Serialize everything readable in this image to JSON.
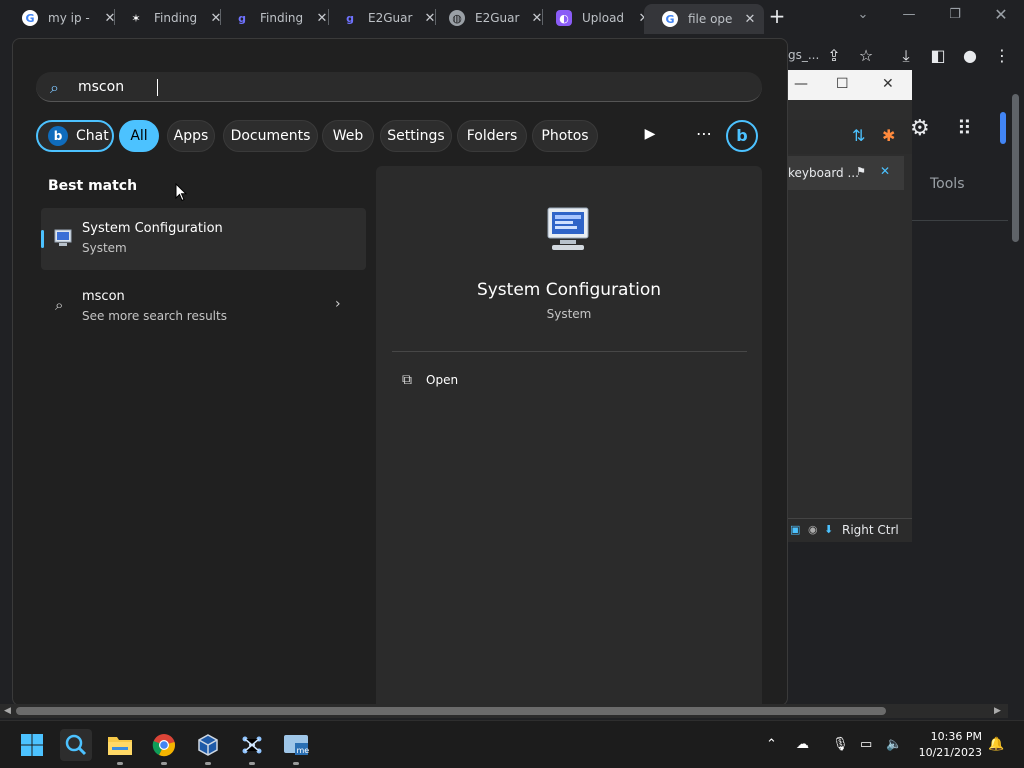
{
  "browser": {
    "tabs": [
      {
        "label": "my ip -",
        "icon": "google-icon"
      },
      {
        "label": "Finding",
        "icon": "spark-icon"
      },
      {
        "label": "Finding",
        "icon": "g-icon"
      },
      {
        "label": "E2Guar",
        "icon": "g-icon"
      },
      {
        "label": "E2Guar",
        "icon": "globe-icon"
      },
      {
        "label": "Upload",
        "icon": "upload-app-icon"
      },
      {
        "label": "file ope",
        "icon": "google-icon"
      }
    ],
    "omnibox_fragment": "gs_...",
    "tools_label": "Tools"
  },
  "vm_window": {
    "tab_label": "keyboard ...",
    "status_label": "Right Ctrl"
  },
  "search": {
    "query": "mscon",
    "filters": [
      "Chat",
      "All",
      "Apps",
      "Documents",
      "Web",
      "Settings",
      "Folders",
      "Photos"
    ],
    "active_filter": "All",
    "best_match_heading": "Best match",
    "best_match": {
      "title": "System Configuration",
      "subtitle": "System"
    },
    "web_result": {
      "title": "mscon",
      "subtitle": "See more search results"
    },
    "preview": {
      "title": "System Configuration",
      "subtitle": "System",
      "action_open": "Open"
    }
  },
  "taskbar": {
    "time": "10:36 PM",
    "date": "10/21/2023"
  },
  "colors": {
    "accent": "#4cc2ff",
    "flyout_bg": "#202020",
    "taskbar_bg": "#1c1c1c"
  }
}
